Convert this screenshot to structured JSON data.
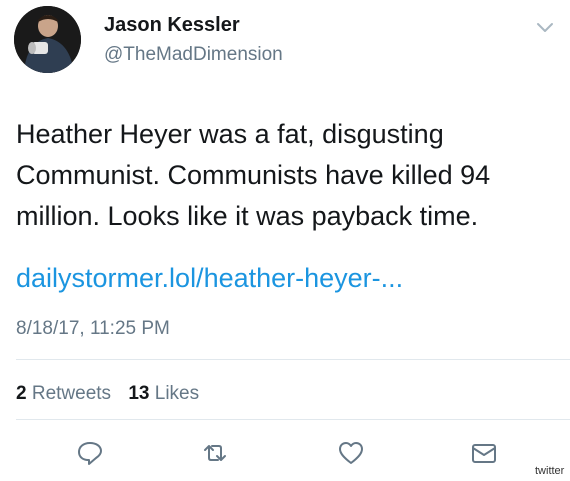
{
  "user": {
    "name": "Jason Kessler",
    "handle": "@TheMadDimension"
  },
  "tweet": {
    "text": "Heather Heyer was a fat, disgusting Communist. Communists have killed 94 million. Looks like it was payback time.",
    "link": "dailystormer.lol/heather-heyer-...",
    "timestamp": "8/18/17, 11:25 PM"
  },
  "stats": {
    "retweets_count": "2",
    "retweets_label": "Retweets",
    "likes_count": "13",
    "likes_label": "Likes"
  },
  "actions": {
    "reply_icon": "reply-icon",
    "retweet_icon": "retweet-icon",
    "like_icon": "heart-icon",
    "message_icon": "envelope-icon"
  },
  "watermark": "twitter",
  "colors": {
    "link": "#1b95e0",
    "secondary_text": "#657786",
    "icon": "#657786",
    "divider": "#e1e8ed"
  }
}
